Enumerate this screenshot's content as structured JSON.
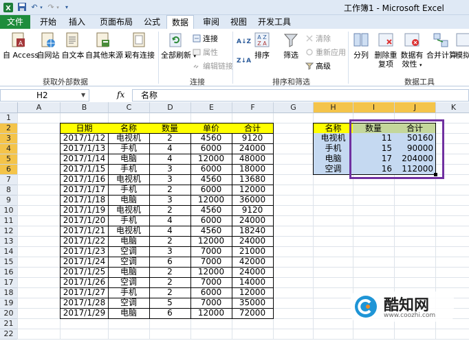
{
  "titlebar": {
    "title": "工作簿1 - Microsoft Excel"
  },
  "tabs": [
    "文件",
    "开始",
    "插入",
    "页面布局",
    "公式",
    "数据",
    "审阅",
    "视图",
    "开发工具"
  ],
  "ribbon": {
    "get_external": {
      "buttons": [
        "自 Access",
        "自网站",
        "自文本",
        "自其他来源",
        "现有连接"
      ],
      "label": "获取外部数据"
    },
    "connections": {
      "refresh_all": "全部刷新",
      "small": [
        "连接",
        "属性",
        "编辑链接"
      ],
      "label": "连接"
    },
    "sort_filter": {
      "sort": "排序",
      "filter": "筛选",
      "small": [
        "清除",
        "重新应用",
        "高级"
      ],
      "label": "排序和筛选"
    },
    "data_tools": {
      "split": "分列",
      "remove_dup": "删除重复项",
      "validation": "数据有效性",
      "consolidate": "合并计算",
      "whatif": "模拟",
      "label": "数据工具"
    },
    "sort_az_icon": "A↓Z",
    "sort_za_icon": "Z↓A"
  },
  "formula_bar": {
    "name_box": "H2",
    "fx": "fx",
    "content": "名称"
  },
  "columns": [
    "A",
    "B",
    "C",
    "D",
    "E",
    "F",
    "G",
    "H",
    "I",
    "J",
    "K"
  ],
  "rows": [
    "1",
    "2",
    "3",
    "4",
    "5",
    "6",
    "7",
    "8",
    "9",
    "10",
    "11",
    "12",
    "13",
    "14",
    "15",
    "16",
    "17",
    "18",
    "19",
    "20",
    "21",
    "22"
  ],
  "main_table": {
    "headers": [
      "日期",
      "名称",
      "数量",
      "单价",
      "合计"
    ],
    "rows": [
      [
        "2017/1/12",
        "电视机",
        "2",
        "4560",
        "9120"
      ],
      [
        "2017/1/13",
        "手机",
        "4",
        "6000",
        "24000"
      ],
      [
        "2017/1/14",
        "电脑",
        "4",
        "12000",
        "48000"
      ],
      [
        "2017/1/15",
        "手机",
        "3",
        "6000",
        "18000"
      ],
      [
        "2017/1/16",
        "电视机",
        "3",
        "4560",
        "13680"
      ],
      [
        "2017/1/17",
        "手机",
        "2",
        "6000",
        "12000"
      ],
      [
        "2017/1/18",
        "电脑",
        "3",
        "12000",
        "36000"
      ],
      [
        "2017/1/19",
        "电视机",
        "2",
        "4560",
        "9120"
      ],
      [
        "2017/1/20",
        "手机",
        "4",
        "6000",
        "24000"
      ],
      [
        "2017/1/21",
        "电视机",
        "4",
        "4560",
        "18240"
      ],
      [
        "2017/1/22",
        "电脑",
        "2",
        "12000",
        "24000"
      ],
      [
        "2017/1/23",
        "空调",
        "3",
        "7000",
        "21000"
      ],
      [
        "2017/1/24",
        "空调",
        "6",
        "7000",
        "42000"
      ],
      [
        "2017/1/25",
        "电脑",
        "2",
        "12000",
        "24000"
      ],
      [
        "2017/1/26",
        "空调",
        "2",
        "7000",
        "14000"
      ],
      [
        "2017/1/27",
        "手机",
        "2",
        "6000",
        "12000"
      ],
      [
        "2017/1/28",
        "空调",
        "5",
        "7000",
        "35000"
      ],
      [
        "2017/1/29",
        "电脑",
        "6",
        "12000",
        "72000"
      ]
    ]
  },
  "summary_table": {
    "headers": [
      "名称",
      "数量",
      "合计"
    ],
    "rows": [
      [
        "电视机",
        "11",
        "50160"
      ],
      [
        "手机",
        "15",
        "90000"
      ],
      [
        "电脑",
        "17",
        "204000"
      ],
      [
        "空调",
        "16",
        "112000"
      ]
    ]
  },
  "watermark": {
    "name": "酷知网",
    "url": "www.coozhi.com"
  },
  "colors": {
    "file_tab": "#1e8d3c",
    "header_yellow": "#ffff00",
    "header_green": "#c4d79b",
    "summary_blue": "#c5d9f1",
    "highlight_purple": "#7030a0",
    "selected_header": "#f4c44a"
  }
}
